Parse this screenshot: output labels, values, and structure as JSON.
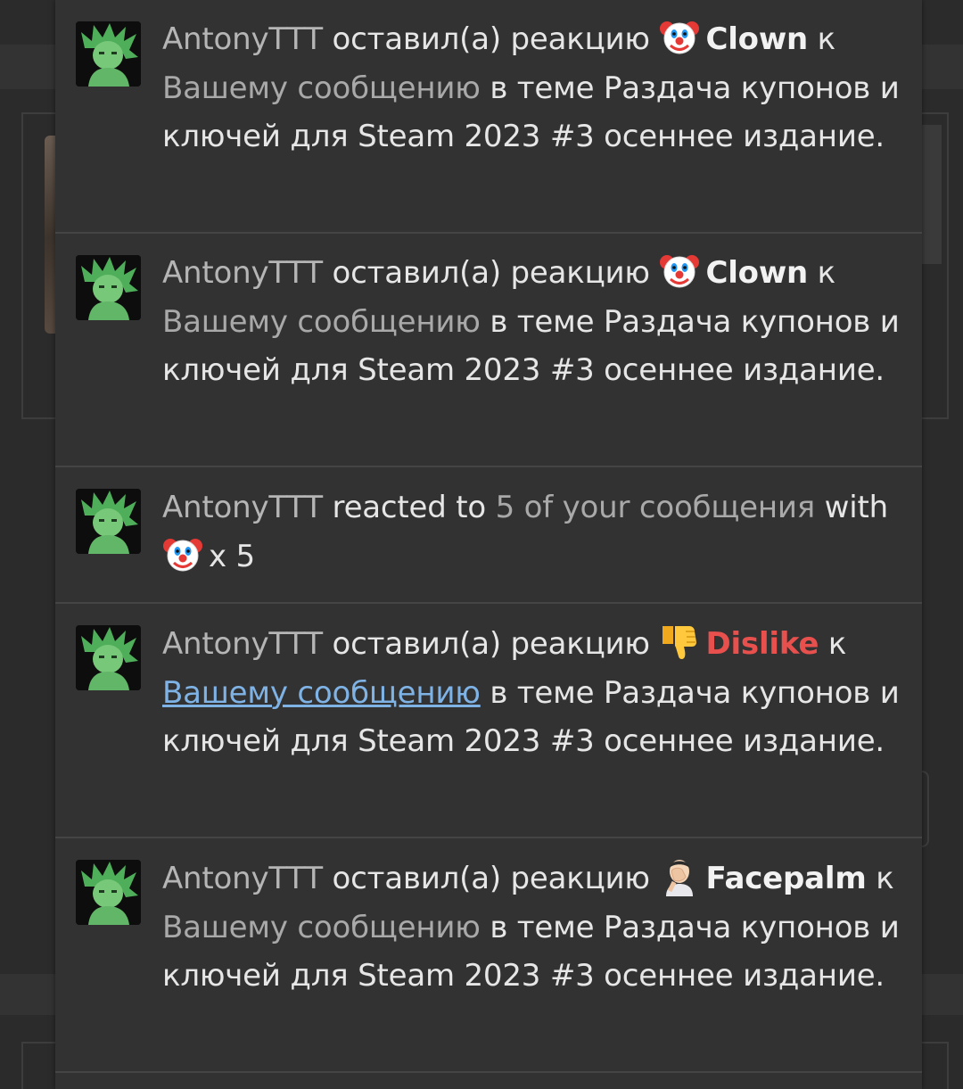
{
  "notifications": [
    {
      "user": "AntonyTTT",
      "action": "оставил(а) реакцию",
      "reaction_icon": "clown-emoji",
      "reaction": "Clown",
      "preposition": "к",
      "target": "Вашему сообщению",
      "thread_prefix": "в теме",
      "thread": "Раздача купонов и ключей для Steam 2023 #3 осеннее издание."
    },
    {
      "user": "AntonyTTT",
      "action": "оставил(а) реакцию",
      "reaction_icon": "clown-emoji",
      "reaction": "Clown",
      "preposition": "к",
      "target": "Вашему сообщению",
      "thread_prefix": "в теме",
      "thread": "Раздача купонов и ключей для Steam 2023 #3 осеннее издание."
    },
    {
      "user": "AntonyTTT",
      "action": "reacted to",
      "target": "5 of your сообщения",
      "with": "with",
      "reaction_icon": "clown-emoji",
      "count": "x 5"
    },
    {
      "user": "AntonyTTT",
      "action": "оставил(а) реакцию",
      "reaction_icon": "thumbs-down-emoji",
      "reaction": "Dislike",
      "preposition": "к",
      "target": "Вашему сообщению",
      "thread_prefix": "в теме",
      "thread": "Раздача купонов и ключей для Steam 2023 #3 осеннее издание."
    },
    {
      "user": "AntonyTTT",
      "action": "оставил(а) реакцию",
      "reaction_icon": "facepalm-emoji",
      "reaction": "Facepalm",
      "preposition": "к",
      "target": "Вашему сообщению",
      "thread_prefix": "в теме",
      "thread": "Раздача купонов и ключей для Steam 2023 #3 осеннее издание."
    }
  ],
  "colors": {
    "panel_bg": "#323232",
    "text": "#e6e6e6",
    "muted": "#a9a9a9",
    "dislike": "#e8504e",
    "link": "#7fb3e6"
  }
}
